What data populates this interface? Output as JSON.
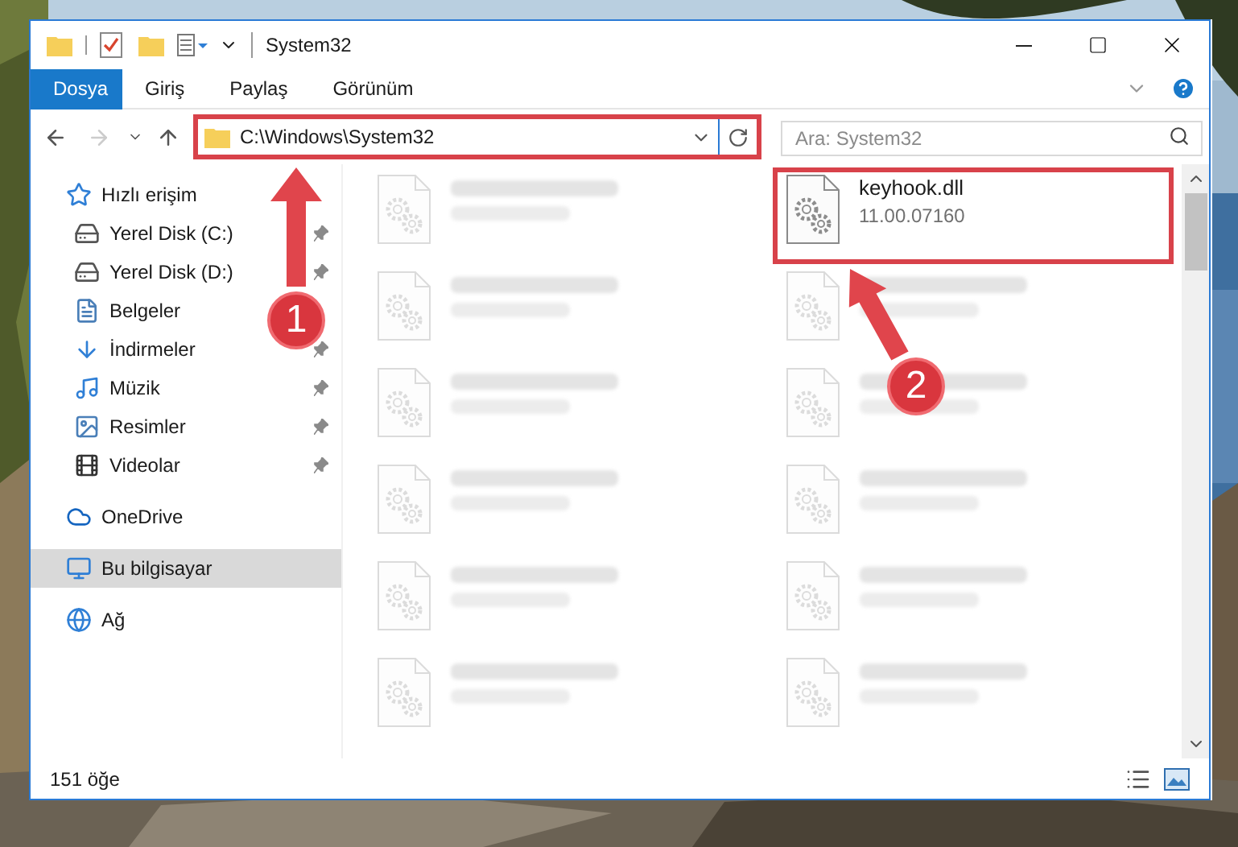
{
  "window": {
    "title": "System32"
  },
  "ribbon_tabs": [
    {
      "label": "Dosya",
      "selected": true
    },
    {
      "label": "Giriş",
      "selected": false
    },
    {
      "label": "Paylaş",
      "selected": false
    },
    {
      "label": "Görünüm",
      "selected": false
    }
  ],
  "address_bar": {
    "path": "C:\\Windows\\System32",
    "highlighted": true
  },
  "nav": {
    "forward_disabled": true
  },
  "search": {
    "placeholder": "Ara: System32"
  },
  "sidebar": {
    "items": [
      {
        "label": "Hızlı erişim",
        "kind": "quick",
        "selected": false,
        "children": [
          {
            "label": "Yerel Disk (C:)",
            "kind": "drive-c",
            "selected": false,
            "pinned": true
          },
          {
            "label": "Yerel Disk (D:)",
            "kind": "drive",
            "selected": false,
            "pinned": true
          },
          {
            "label": "Belgeler",
            "kind": "documents",
            "selected": false,
            "pinned": false
          },
          {
            "label": "İndirmeler",
            "kind": "downloads",
            "selected": false,
            "pinned": true
          },
          {
            "label": "Müzik",
            "kind": "music",
            "selected": false,
            "pinned": true
          },
          {
            "label": "Resimler",
            "kind": "pictures",
            "selected": false,
            "pinned": true
          },
          {
            "label": "Videolar",
            "kind": "videos",
            "selected": false,
            "pinned": true
          }
        ]
      },
      {
        "label": "OneDrive",
        "kind": "cloud",
        "selected": false
      },
      {
        "label": "Bu bilgisayar",
        "kind": "computer",
        "selected": true
      },
      {
        "label": "Ağ",
        "kind": "network",
        "selected": false
      }
    ]
  },
  "files": [
    {
      "kind": "blurred"
    },
    {
      "kind": "file",
      "name": "keyhook.dll",
      "detail": "11.00.07160",
      "highlighted": true
    },
    {
      "kind": "blurred"
    },
    {
      "kind": "blurred"
    },
    {
      "kind": "blurred"
    },
    {
      "kind": "blurred"
    },
    {
      "kind": "blurred"
    },
    {
      "kind": "blurred"
    },
    {
      "kind": "blurred"
    },
    {
      "kind": "blurred"
    },
    {
      "kind": "blurred"
    },
    {
      "kind": "blurred"
    }
  ],
  "status_bar": {
    "count": "151 öğe"
  },
  "annotations": [
    {
      "label": "1"
    },
    {
      "label": "2"
    }
  ]
}
